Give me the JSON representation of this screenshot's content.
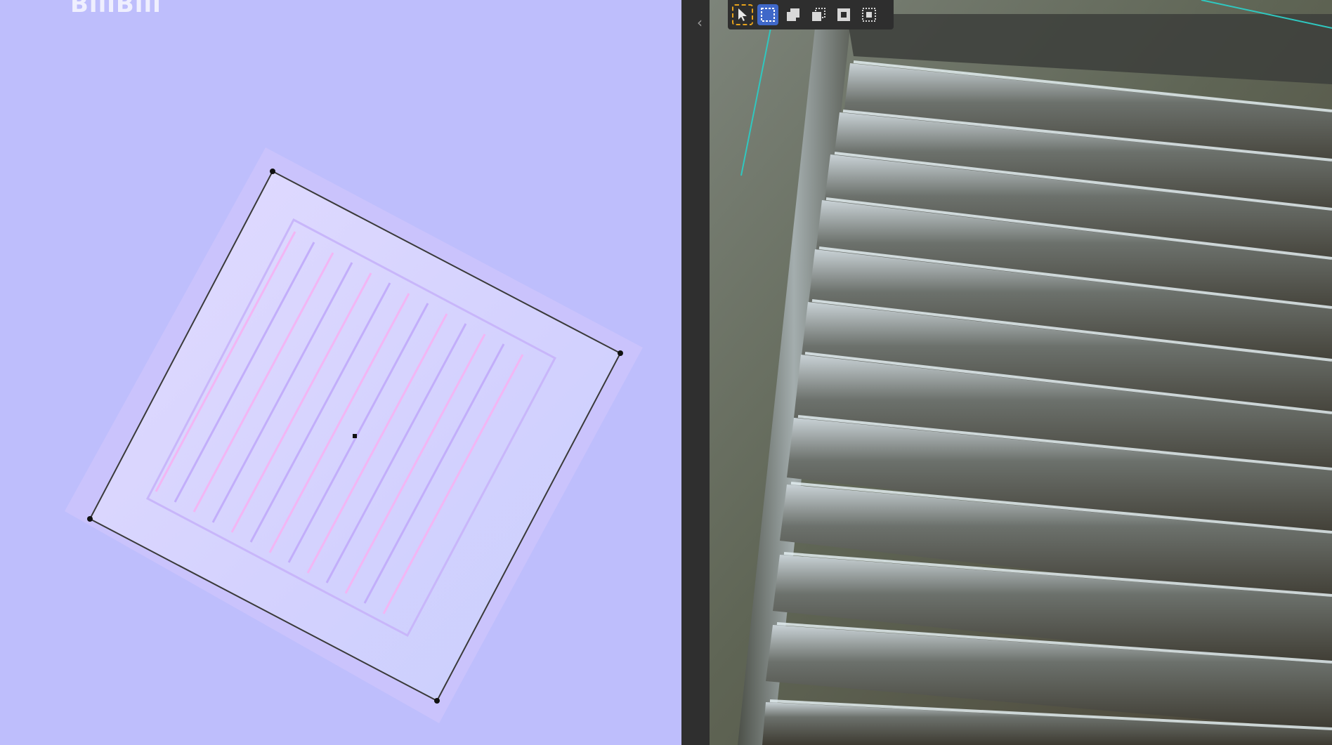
{
  "uv_editor": {
    "watermark": "BiliBili",
    "background_color": "#bebefc"
  },
  "divider": {
    "collapse_icon": "chevron-left-icon"
  },
  "toolbar": {
    "tools": [
      {
        "name": "select-cursor",
        "icon": "cursor-icon",
        "active": false
      },
      {
        "name": "select-box",
        "icon": "select-box-icon",
        "active": true
      },
      {
        "name": "select-extend",
        "icon": "select-extend-icon",
        "active": false
      },
      {
        "name": "select-subtract",
        "icon": "select-subtract-icon",
        "active": false
      },
      {
        "name": "select-invert",
        "icon": "select-invert-icon",
        "active": false
      },
      {
        "name": "select-intersect",
        "icon": "select-intersect-icon",
        "active": false
      }
    ],
    "accent_color": "#3f68c9",
    "highlight_color": "#e6a21c"
  }
}
